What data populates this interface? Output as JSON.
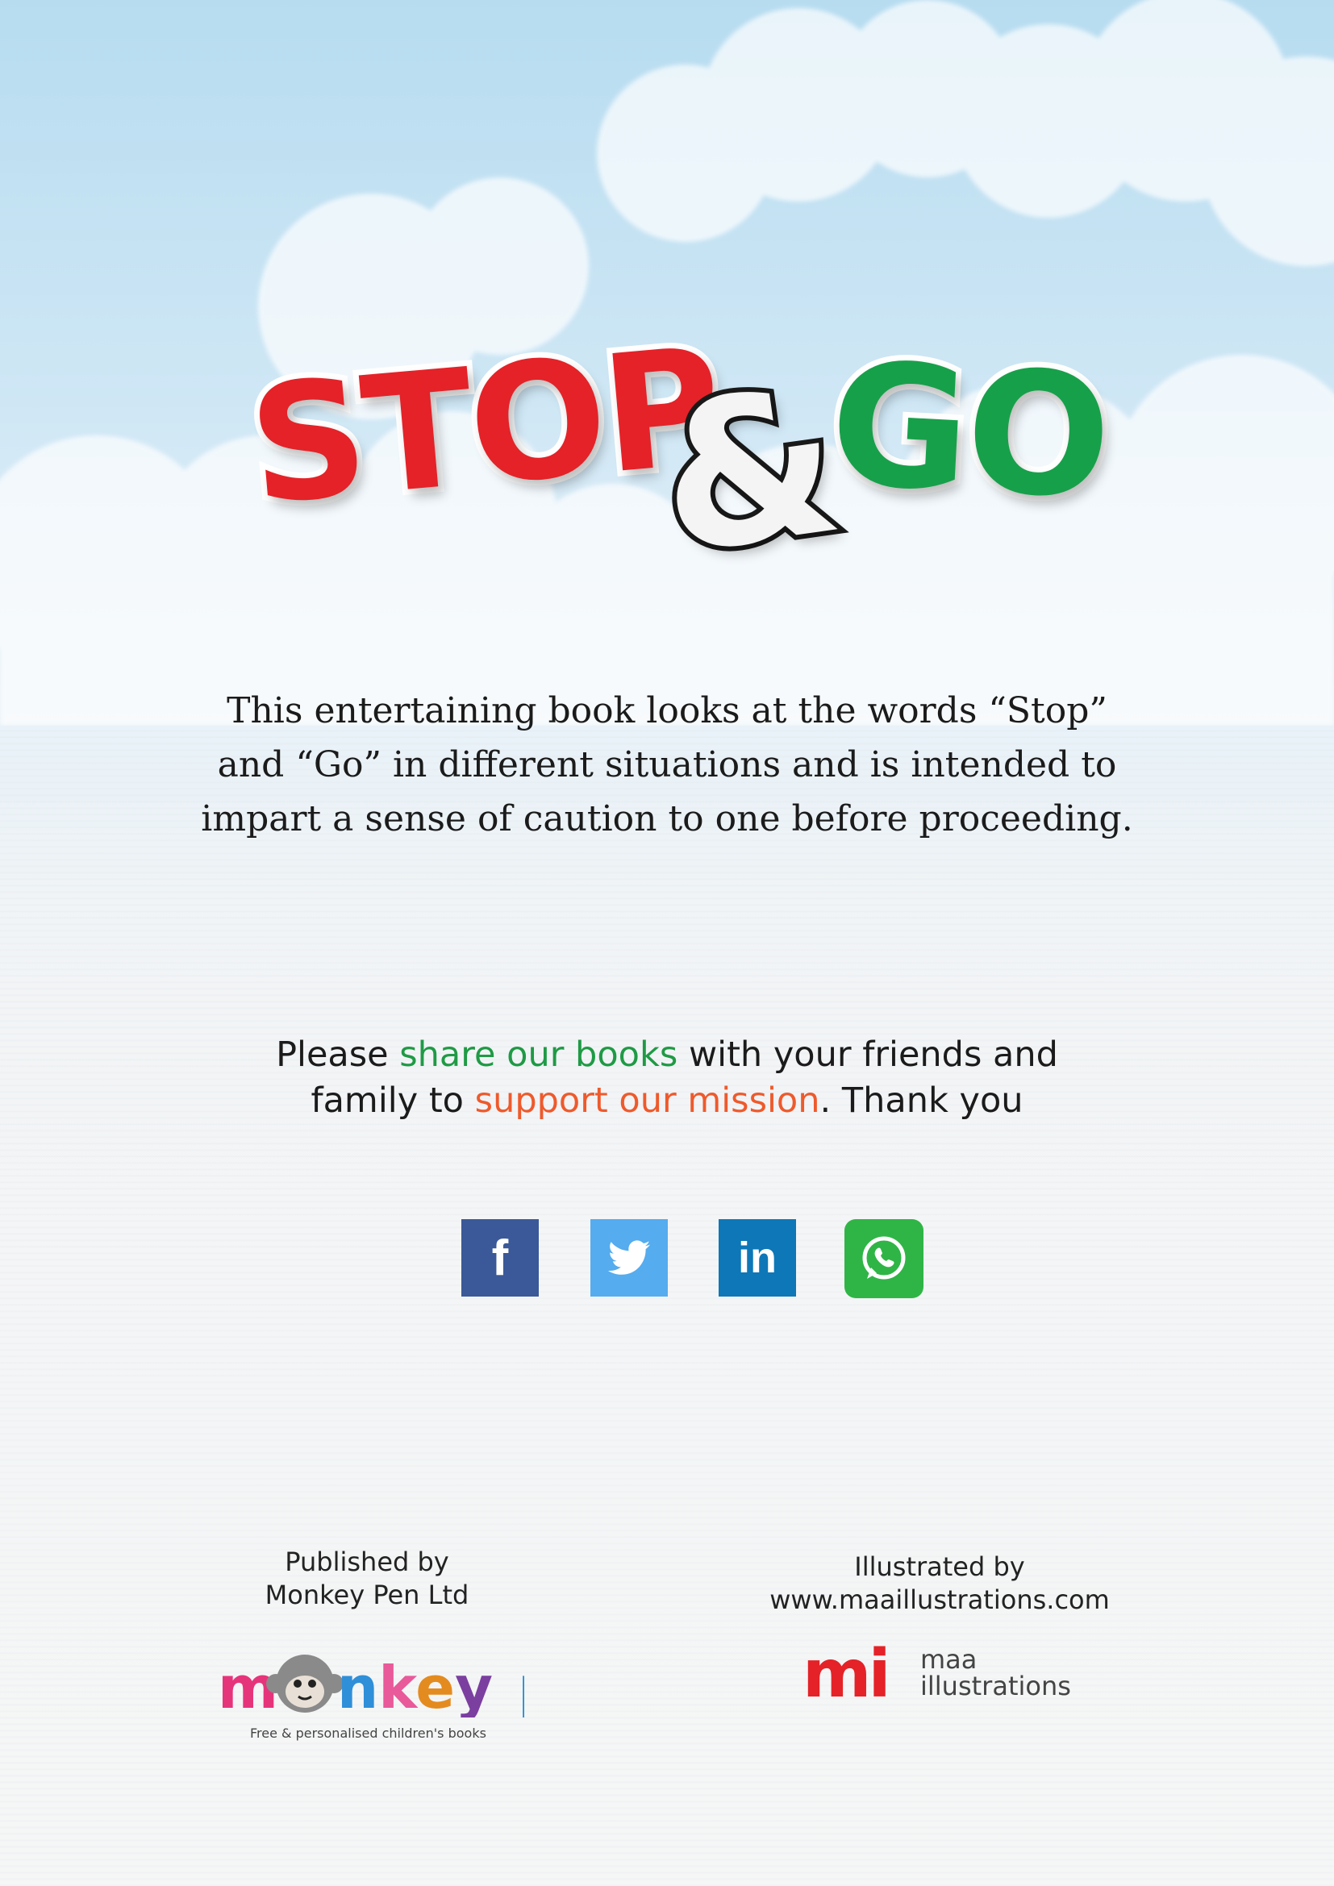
{
  "logo": {
    "word1": "STOP",
    "ampersand": "&",
    "word2": "GO",
    "colors": {
      "stop": "#e42228",
      "go": "#17a04a",
      "ampersand": "#f4f4f4"
    }
  },
  "blurb": {
    "line1": "This entertaining book looks at the words “Stop”",
    "line2": "and “Go” in different situations and is intended to",
    "line3": "impart a sense of caution to one before proceeding."
  },
  "share": {
    "part1": "Please ",
    "highlight1": "share our books",
    "part2": " with your friends and",
    "part3": "family to ",
    "highlight2": "support our mission",
    "part4": ". Thank you",
    "colors": {
      "highlight1": "#1f9a45",
      "highlight2": "#ee5a2c"
    }
  },
  "social": [
    {
      "icon": "facebook-icon",
      "glyph": "f",
      "color": "#3b5998"
    },
    {
      "icon": "twitter-icon",
      "glyph": "",
      "color": "#55acee"
    },
    {
      "icon": "linkedin-icon",
      "glyph": "in",
      "color": "#0e77b7"
    },
    {
      "icon": "whatsapp-icon",
      "glyph": "",
      "color": "#2fb546"
    }
  ],
  "publisher": {
    "label": "Published by",
    "name": "Monkey Pen Ltd",
    "logo_text": "monkey pen",
    "tagline": "Free & personalised children's books"
  },
  "illustrator": {
    "label": "Illustrated by",
    "url": "www.maaillustrations.com",
    "logo_mark": "mi",
    "logo_line1": "maa",
    "logo_line2": "illustrations"
  }
}
